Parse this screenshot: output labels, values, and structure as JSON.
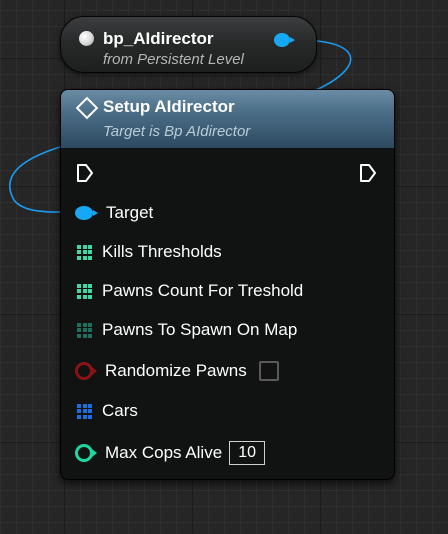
{
  "variable_node": {
    "title": "bp_AIdirector",
    "subtitle": "from Persistent Level"
  },
  "function_node": {
    "title": "Setup AIdirector",
    "subtitle": "Target is Bp AIdirector",
    "pins": [
      {
        "label": "Target",
        "type": "object",
        "color": "#17a8f5"
      },
      {
        "label": "Kills Thresholds",
        "type": "array",
        "color": "#3fd9a8"
      },
      {
        "label": "Pawns Count For Treshold",
        "type": "array",
        "color": "#3fd9a8"
      },
      {
        "label": "Pawns To Spawn On Map",
        "type": "array",
        "color": "#1f6f5f"
      },
      {
        "label": "Randomize Pawns",
        "type": "bool",
        "color": "#8a1212"
      },
      {
        "label": "Cars",
        "type": "array",
        "color": "#1d6fe0"
      },
      {
        "label": "Max Cops Alive",
        "type": "int",
        "color": "#1ed6a0",
        "value": "10"
      }
    ]
  },
  "colors": {
    "wire": "#1b9af0",
    "header_top": "#6a8ca5",
    "header_bottom": "#2c4a60",
    "exec": "#ffffff"
  }
}
